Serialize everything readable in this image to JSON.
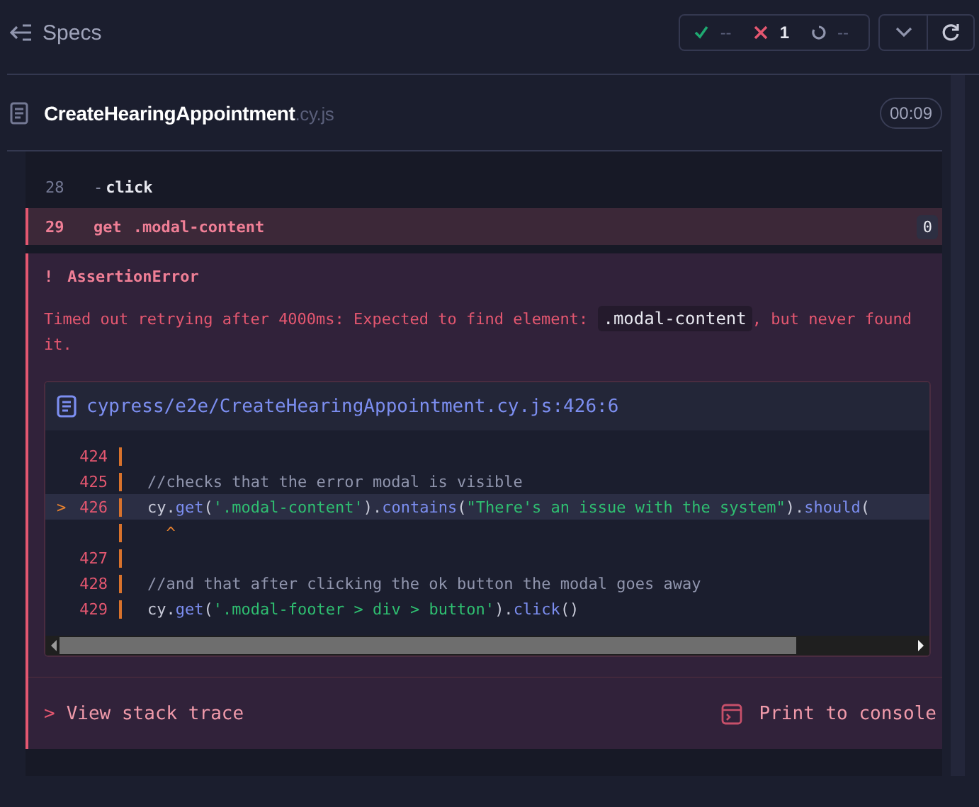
{
  "header": {
    "title": "Specs",
    "stats": [
      {
        "kind": "passed",
        "count": "--"
      },
      {
        "kind": "failed",
        "count": "1"
      },
      {
        "kind": "pending",
        "count": "--"
      }
    ]
  },
  "spec": {
    "name": "CreateHearingAppointment",
    "ext": ".cy.js",
    "duration": "00:09"
  },
  "commands": [
    {
      "number": "28",
      "prefix": "-",
      "name": "click",
      "failed": false
    },
    {
      "number": "29",
      "name": "get",
      "message": ".modal-content",
      "failed": true,
      "badge": "0"
    }
  ],
  "error": {
    "mark": "!",
    "title": "AssertionError",
    "message_before": "Timed out retrying after 4000ms: Expected to find element: ",
    "message_code": ".modal-content",
    "message_after": ", but never found it.",
    "frame": {
      "file": "cypress/e2e/CreateHearingAppointment.cy.js:426:6",
      "lines": [
        {
          "number": "424",
          "current": false
        },
        {
          "number": "425",
          "current": false,
          "tokens": [
            {
              "kind": "comment",
              "text": "//checks that the error modal is visible"
            }
          ]
        },
        {
          "number": "426",
          "current": true,
          "pointer": ">",
          "tokens": [
            {
              "kind": "plain",
              "text": "cy."
            },
            {
              "kind": "fn",
              "text": "get"
            },
            {
              "kind": "plain",
              "text": "("
            },
            {
              "kind": "str",
              "text": "'.modal-content'"
            },
            {
              "kind": "plain",
              "text": ")."
            },
            {
              "kind": "fn",
              "text": "contains"
            },
            {
              "kind": "plain",
              "text": "("
            },
            {
              "kind": "str",
              "text": "\"There's an issue with the system\""
            },
            {
              "kind": "plain",
              "text": ")."
            },
            {
              "kind": "fn",
              "text": "should"
            },
            {
              "kind": "plain",
              "text": "("
            }
          ]
        },
        {
          "current": false,
          "tokens": [
            {
              "kind": "caret",
              "text": "  ^"
            }
          ]
        },
        {
          "number": "427",
          "current": false
        },
        {
          "number": "428",
          "current": false,
          "tokens": [
            {
              "kind": "comment",
              "text": "//and that after clicking the ok button the modal goes away"
            }
          ]
        },
        {
          "number": "429",
          "current": false,
          "tokens": [
            {
              "kind": "plain",
              "text": "cy."
            },
            {
              "kind": "fn",
              "text": "get"
            },
            {
              "kind": "plain",
              "text": "("
            },
            {
              "kind": "str",
              "text": "'.modal-footer > div > button'"
            },
            {
              "kind": "plain",
              "text": ")."
            },
            {
              "kind": "fn",
              "text": "click"
            },
            {
              "kind": "plain",
              "text": "()"
            }
          ]
        }
      ]
    },
    "stack_trace": {
      "chevron": ">",
      "label": "View stack trace"
    },
    "print": {
      "label": "Print to console"
    }
  }
}
